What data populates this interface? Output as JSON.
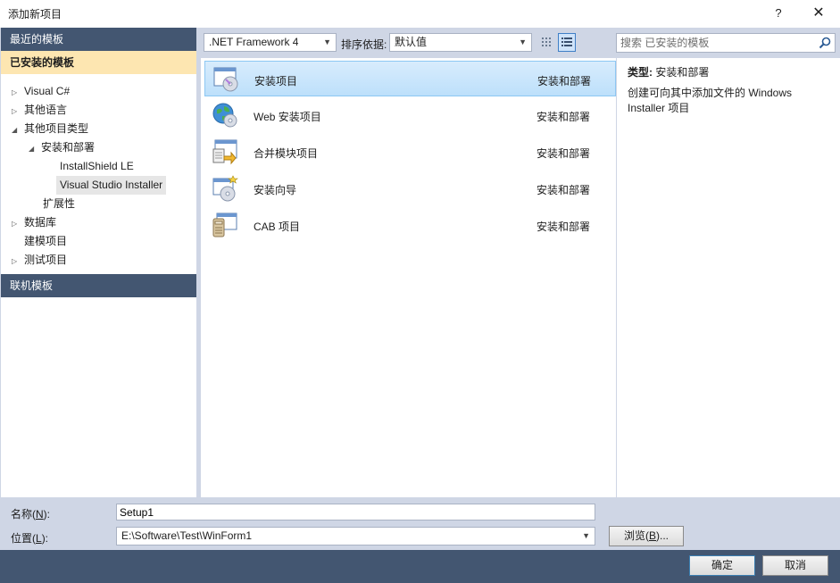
{
  "window": {
    "title": "添加新项目",
    "help": "?",
    "close": "✕"
  },
  "left": {
    "recent_head": "最近的模板",
    "installed_head": "已安装的模板",
    "online_head": "联机模板",
    "tree": [
      {
        "label": "Visual C#",
        "arrow": "▷"
      },
      {
        "label": "其他语言",
        "arrow": "▷"
      },
      {
        "label": "其他项目类型",
        "arrow": "◢"
      },
      {
        "label": "安装和部署",
        "arrow": "◢"
      },
      {
        "label": "InstallShield LE",
        "arrow": ""
      },
      {
        "label": "Visual Studio Installer",
        "arrow": ""
      },
      {
        "label": "扩展性",
        "arrow": ""
      },
      {
        "label": "数据库",
        "arrow": "▷"
      },
      {
        "label": "建模项目",
        "arrow": ""
      },
      {
        "label": "测试项目",
        "arrow": "▷"
      }
    ]
  },
  "toolbar": {
    "framework": ".NET Framework 4",
    "sort_label": "排序依据:",
    "sort_value": "默认值"
  },
  "search": {
    "placeholder": "搜索 已安装的模板"
  },
  "templates": [
    {
      "name": "安装项目",
      "category": "安装和部署",
      "icon": "setup-project-icon"
    },
    {
      "name": "Web 安装项目",
      "category": "安装和部署",
      "icon": "web-setup-project-icon"
    },
    {
      "name": "合并模块项目",
      "category": "安装和部署",
      "icon": "merge-module-icon"
    },
    {
      "name": "安装向导",
      "category": "安装和部署",
      "icon": "setup-wizard-icon"
    },
    {
      "name": "CAB 项目",
      "category": "安装和部署",
      "icon": "cab-project-icon"
    }
  ],
  "detail": {
    "type_label": "类型:",
    "type_value": "安装和部署",
    "description": "创建可向其中添加文件的 Windows Installer 项目"
  },
  "bottom": {
    "name_label_pre": "名称(",
    "name_label_key": "N",
    "name_label_post": "):",
    "name_value": "Setup1",
    "loc_label_pre": "位置(",
    "loc_label_key": "L",
    "loc_label_post": "):",
    "loc_value": "E:\\Software\\Test\\WinForm1",
    "browse_pre": "浏览(",
    "browse_key": "B",
    "browse_post": ")...",
    "ok": "确定",
    "cancel": "取消"
  },
  "colors": {
    "header": "#435671",
    "selected_head": "#fde6b1",
    "frame": "#cfd6e5",
    "selection": "#bde0fb"
  }
}
